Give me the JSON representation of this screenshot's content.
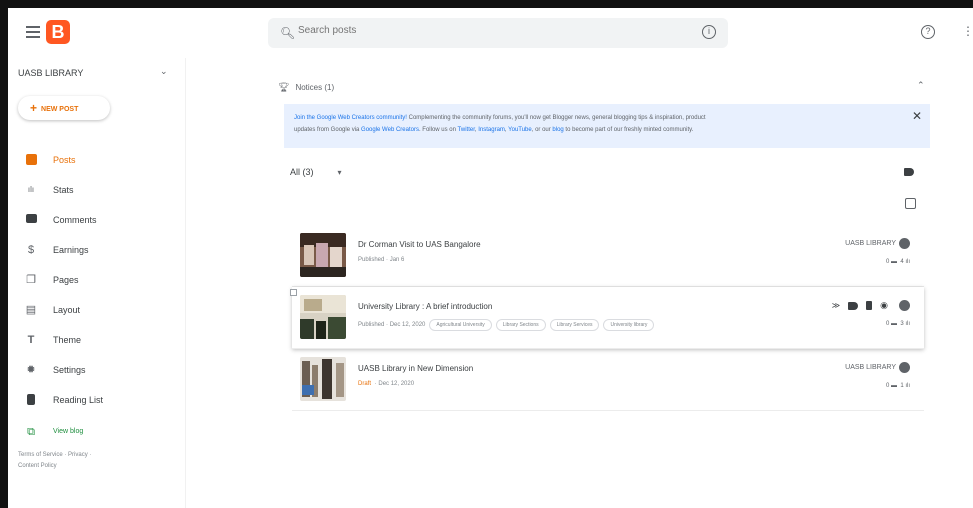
{
  "topbar": {
    "logo_letter": "B",
    "search_placeholder": "Search posts",
    "search_icon": "search-icon",
    "info_icon": "info-icon",
    "help_icon": "help-icon"
  },
  "sidebar": {
    "blog_name": "UASB LIBRARY",
    "new_post_label": "NEW POST",
    "items": [
      {
        "label": "Posts",
        "icon": "posts-icon",
        "glyph": "■"
      },
      {
        "label": "Stats",
        "icon": "stats-icon",
        "glyph": "ılı"
      },
      {
        "label": "Comments",
        "icon": "comments-icon",
        "glyph": "▬"
      },
      {
        "label": "Earnings",
        "icon": "earnings-icon",
        "glyph": "$"
      },
      {
        "label": "Pages",
        "icon": "pages-icon",
        "glyph": "❐"
      },
      {
        "label": "Layout",
        "icon": "layout-icon",
        "glyph": "▤"
      },
      {
        "label": "Theme",
        "icon": "theme-icon",
        "glyph": "T"
      },
      {
        "label": "Settings",
        "icon": "settings-icon",
        "glyph": "✹"
      },
      {
        "label": "Reading List",
        "icon": "bookmark-icon",
        "glyph": "▮"
      },
      {
        "label": "View blog",
        "icon": "view-blog-icon",
        "glyph": "⧉"
      }
    ],
    "footer": [
      "Terms of Service",
      "Privacy",
      "Content Policy"
    ]
  },
  "notices": {
    "header": "Notices (1)",
    "banner": {
      "link1": "Join the Google Web Creators community!",
      "text1": " Complementing the community forums, you'll now get Blogger news, general blogging tips & inspiration, product",
      "text2": "updates from Google via ",
      "link2": "Google Web Creators",
      "text3": ". Follow us on ",
      "link3": "Twitter",
      "sep1": ", ",
      "link4": "Instagram",
      "sep2": ", ",
      "link5": "YouTube",
      "text4": ", or our ",
      "link6": "blog",
      "text5": " to become part of our freshly minted community."
    }
  },
  "filter": {
    "label": "All (3)"
  },
  "posts": [
    {
      "title": "Dr Corman Visit to UAS Bangalore",
      "status": "Published",
      "date": "Jan 6",
      "author": "UASB LIBRARY",
      "comments": "0",
      "views": "4",
      "labels": []
    },
    {
      "title": "University Library : A brief introduction",
      "status": "Published",
      "date": "Dec 12, 2020",
      "author": "",
      "comments": "0",
      "views": "3",
      "labels": [
        "Agricultural University",
        "Library Sections",
        "Library Services",
        "University library"
      ]
    },
    {
      "title": "UASB Library in New Dimension",
      "status": "Draft",
      "date": "Dec 12, 2020",
      "author": "UASB LIBRARY",
      "comments": "0",
      "views": "1",
      "labels": []
    }
  ],
  "colors": {
    "accent": "#e8710a",
    "brand": "#ff5722",
    "banner_bg": "#e8f0fe",
    "link": "#1a73e8",
    "view_blog": "#1e8e3e"
  }
}
